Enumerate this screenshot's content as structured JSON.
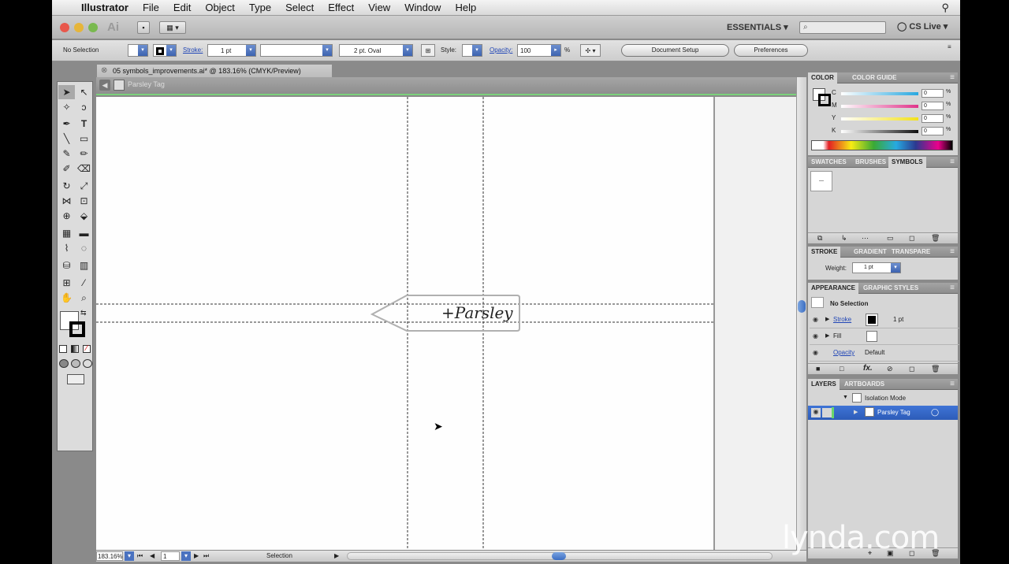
{
  "menubar": {
    "app": "Illustrator",
    "items": [
      "File",
      "Edit",
      "Object",
      "Type",
      "Select",
      "Effect",
      "View",
      "Window",
      "Help"
    ]
  },
  "appbar": {
    "logo": "Ai",
    "workspace": "ESSENTIALS ▾",
    "search_placeholder": "",
    "cslive": "CS Live ▾"
  },
  "control": {
    "selection_label": "No Selection",
    "stroke_label": "Stroke:",
    "stroke_value": "1 pt",
    "brush_value": "2 pt. Oval",
    "style_label": "Style:",
    "opacity_label": "Opacity:",
    "opacity_value": "100",
    "opacity_unit": "%",
    "document_setup": "Document Setup",
    "preferences": "Preferences"
  },
  "document": {
    "tab_title": "05 symbols_improvements.ai* @ 183.16% (CMYK/Preview)",
    "isolation_name": "Parsley Tag",
    "tag_text": "+Parsley"
  },
  "status": {
    "zoom": "183.16%",
    "artboard": "1",
    "tool": "Selection"
  },
  "panels": {
    "color_tabs": [
      "COLOR",
      "COLOR GUIDE"
    ],
    "cmyk": [
      {
        "label": "C",
        "value": "0",
        "color": "#29a8e0"
      },
      {
        "label": "M",
        "value": "0",
        "color": "#e0338a"
      },
      {
        "label": "Y",
        "value": "0",
        "color": "#f2e11b"
      },
      {
        "label": "K",
        "value": "0",
        "color": "#111111"
      }
    ],
    "percent": "%",
    "symbols_tabs": [
      "SWATCHES",
      "BRUSHES",
      "SYMBOLS"
    ],
    "stroke_tabs": [
      "STROKE",
      "GRADIENT",
      "TRANSPARE"
    ],
    "weight_label": "Weight:",
    "weight_value": "1 pt",
    "appearance_tabs": [
      "APPEARANCE",
      "GRAPHIC STYLES"
    ],
    "appearance_header": "No Selection",
    "appearance_rows": [
      {
        "name": "Stroke",
        "value": "1 pt"
      },
      {
        "name": "Fill",
        "value": ""
      },
      {
        "name": "Opacity",
        "value": "Default"
      }
    ],
    "layers_tabs": [
      "LAYERS",
      "ARTBOARDS"
    ],
    "layers": [
      {
        "name": "Isolation Mode"
      },
      {
        "name": "Parsley Tag"
      }
    ]
  },
  "watermark": "lynda.com"
}
